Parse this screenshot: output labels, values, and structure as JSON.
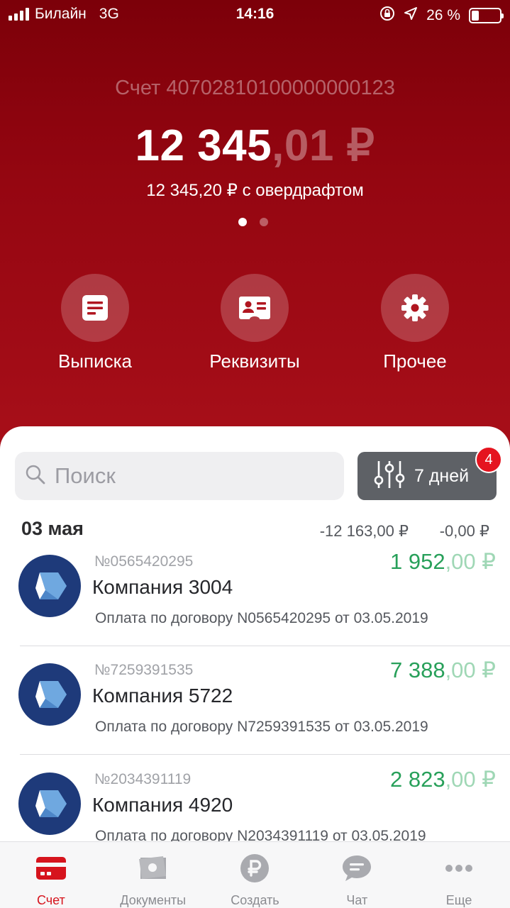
{
  "status_bar": {
    "carrier": "Билайн",
    "network": "3G",
    "time": "14:16",
    "battery": "26 %",
    "battery_level": 0.26
  },
  "account": {
    "label": "Счет 40702810100000000123",
    "balance_main": "12 345",
    "balance_fraction": ",01 ₽",
    "overdraft": "12 345,20 ₽ с овердрафтом",
    "page_index": 1,
    "page_count": 2
  },
  "actions": [
    {
      "label": "Выписка",
      "icon": "statement-icon"
    },
    {
      "label": "Реквизиты",
      "icon": "id-card-icon"
    },
    {
      "label": "Прочее",
      "icon": "gear-icon"
    }
  ],
  "search": {
    "placeholder": "Поиск"
  },
  "filter": {
    "label": "7 дней",
    "badge": "4"
  },
  "day": {
    "title": "03 мая",
    "sum_out": "-12 163,00 ₽",
    "sum_in": "-0,00 ₽"
  },
  "transactions": [
    {
      "number": "№0565420295",
      "name": "Компания 3004",
      "amount_main": "1 952",
      "amount_fraction": ",00 ₽",
      "description": "Оплата по договору N0565420295 от 03.05.2019"
    },
    {
      "number": "№7259391535",
      "name": "Компания 5722",
      "amount_main": "7 388",
      "amount_fraction": ",00 ₽",
      "description": "Оплата по договору N7259391535 от 03.05.2019"
    },
    {
      "number": "№2034391119",
      "name": "Компания 4920",
      "amount_main": "2 823",
      "amount_fraction": ",00 ₽",
      "description": "Оплата по договору N2034391119 от 03.05.2019"
    }
  ],
  "tabbar": [
    {
      "label": "Счет",
      "icon": "card-icon",
      "active": true
    },
    {
      "label": "Документы",
      "icon": "documents-icon",
      "active": false
    },
    {
      "label": "Создать",
      "icon": "ruble-icon",
      "active": false
    },
    {
      "label": "Чат",
      "icon": "chat-icon",
      "active": false
    },
    {
      "label": "Еще",
      "icon": "more-icon",
      "active": false
    }
  ],
  "colors": {
    "header": "#950611",
    "positive_amount": "#28a05a",
    "active_tab": "#d6141d",
    "badge": "#e5141f"
  }
}
